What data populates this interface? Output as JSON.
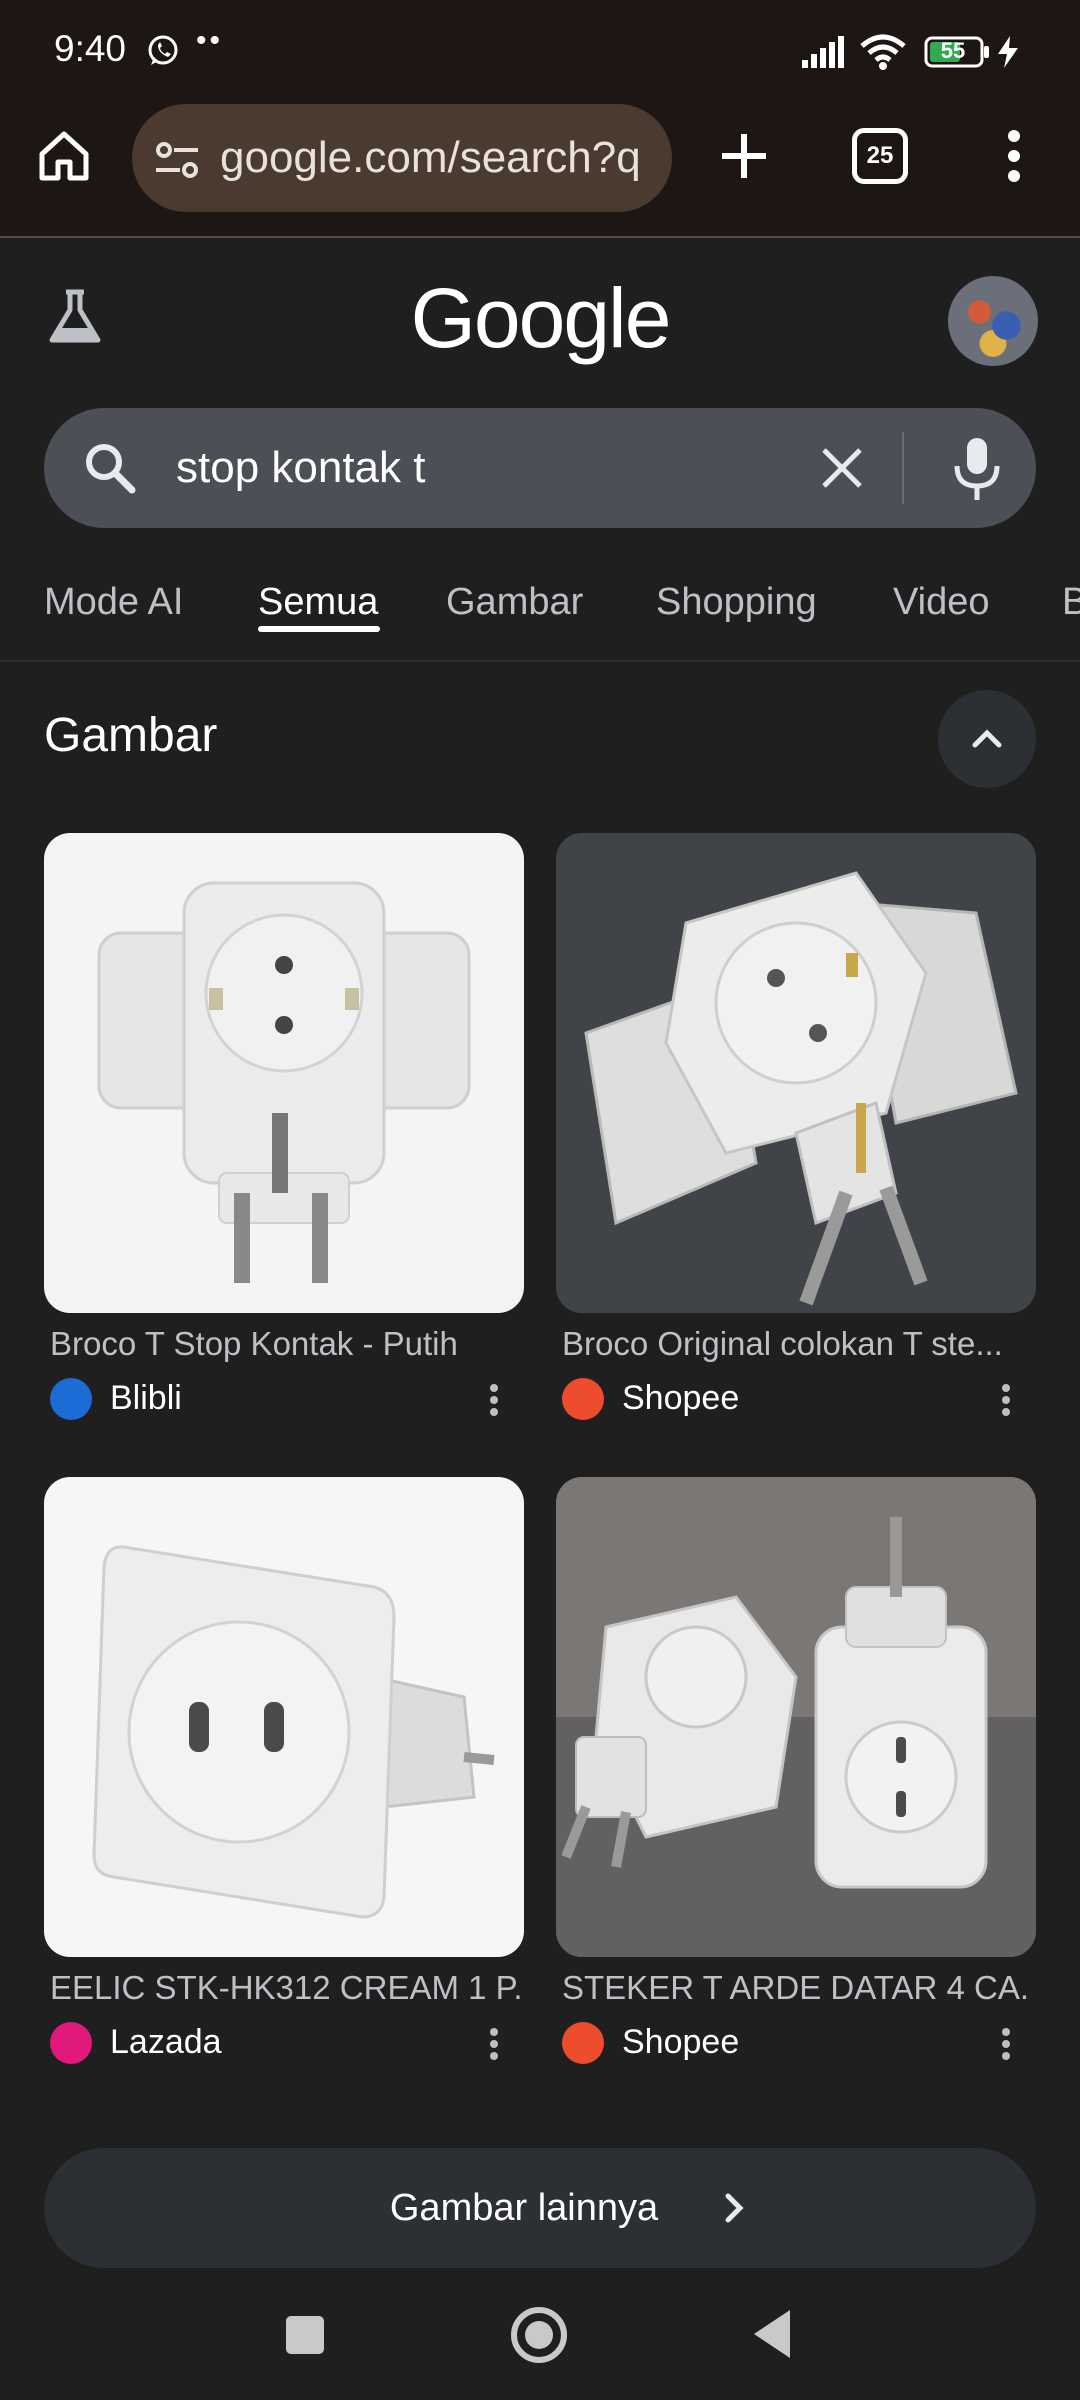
{
  "status_bar": {
    "time": "9:40",
    "battery": "55"
  },
  "browser": {
    "url": "google.com/search?q",
    "tab_count": "25"
  },
  "google": {
    "logo": "Google",
    "search_query": "stop kontak t"
  },
  "tabs": [
    {
      "label": "Mode AI",
      "active": false
    },
    {
      "label": "Semua",
      "active": true
    },
    {
      "label": "Gambar",
      "active": false
    },
    {
      "label": "Shopping",
      "active": false
    },
    {
      "label": "Video",
      "active": false
    },
    {
      "label": "B",
      "active": false
    }
  ],
  "images_section": {
    "title": "Gambar",
    "results": [
      {
        "title": "Broco T Stop Kontak - Putih",
        "source": "Blibli",
        "source_icon": "blibli-logo-icon",
        "image": "white-t-socket-adapter-on-white"
      },
      {
        "title": "Broco Original colokan T ste...",
        "source": "Shopee",
        "source_icon": "shopee-logo-icon",
        "image": "white-t-socket-adapter-on-dark"
      },
      {
        "title": "EELIC STK-HK312 CREAM 1 P...",
        "source": "Lazada",
        "source_icon": "lazada-logo-icon",
        "image": "white-square-socket-adapter"
      },
      {
        "title": "STEKER T ARDE DATAR 4 CA...",
        "source": "Shopee",
        "source_icon": "shopee-logo-icon",
        "image": "two-t-adapters-on-stone"
      }
    ],
    "more_label": "Gambar lainnya"
  },
  "colors": {
    "background": "#1f1f1f",
    "toolbar": "#1e1515",
    "url_bar": "#4b3a30",
    "search_box": "#4c5056",
    "blibli": "#1c6bd6",
    "shopee": "#ee4d2d",
    "lazada": "#e0197a"
  }
}
